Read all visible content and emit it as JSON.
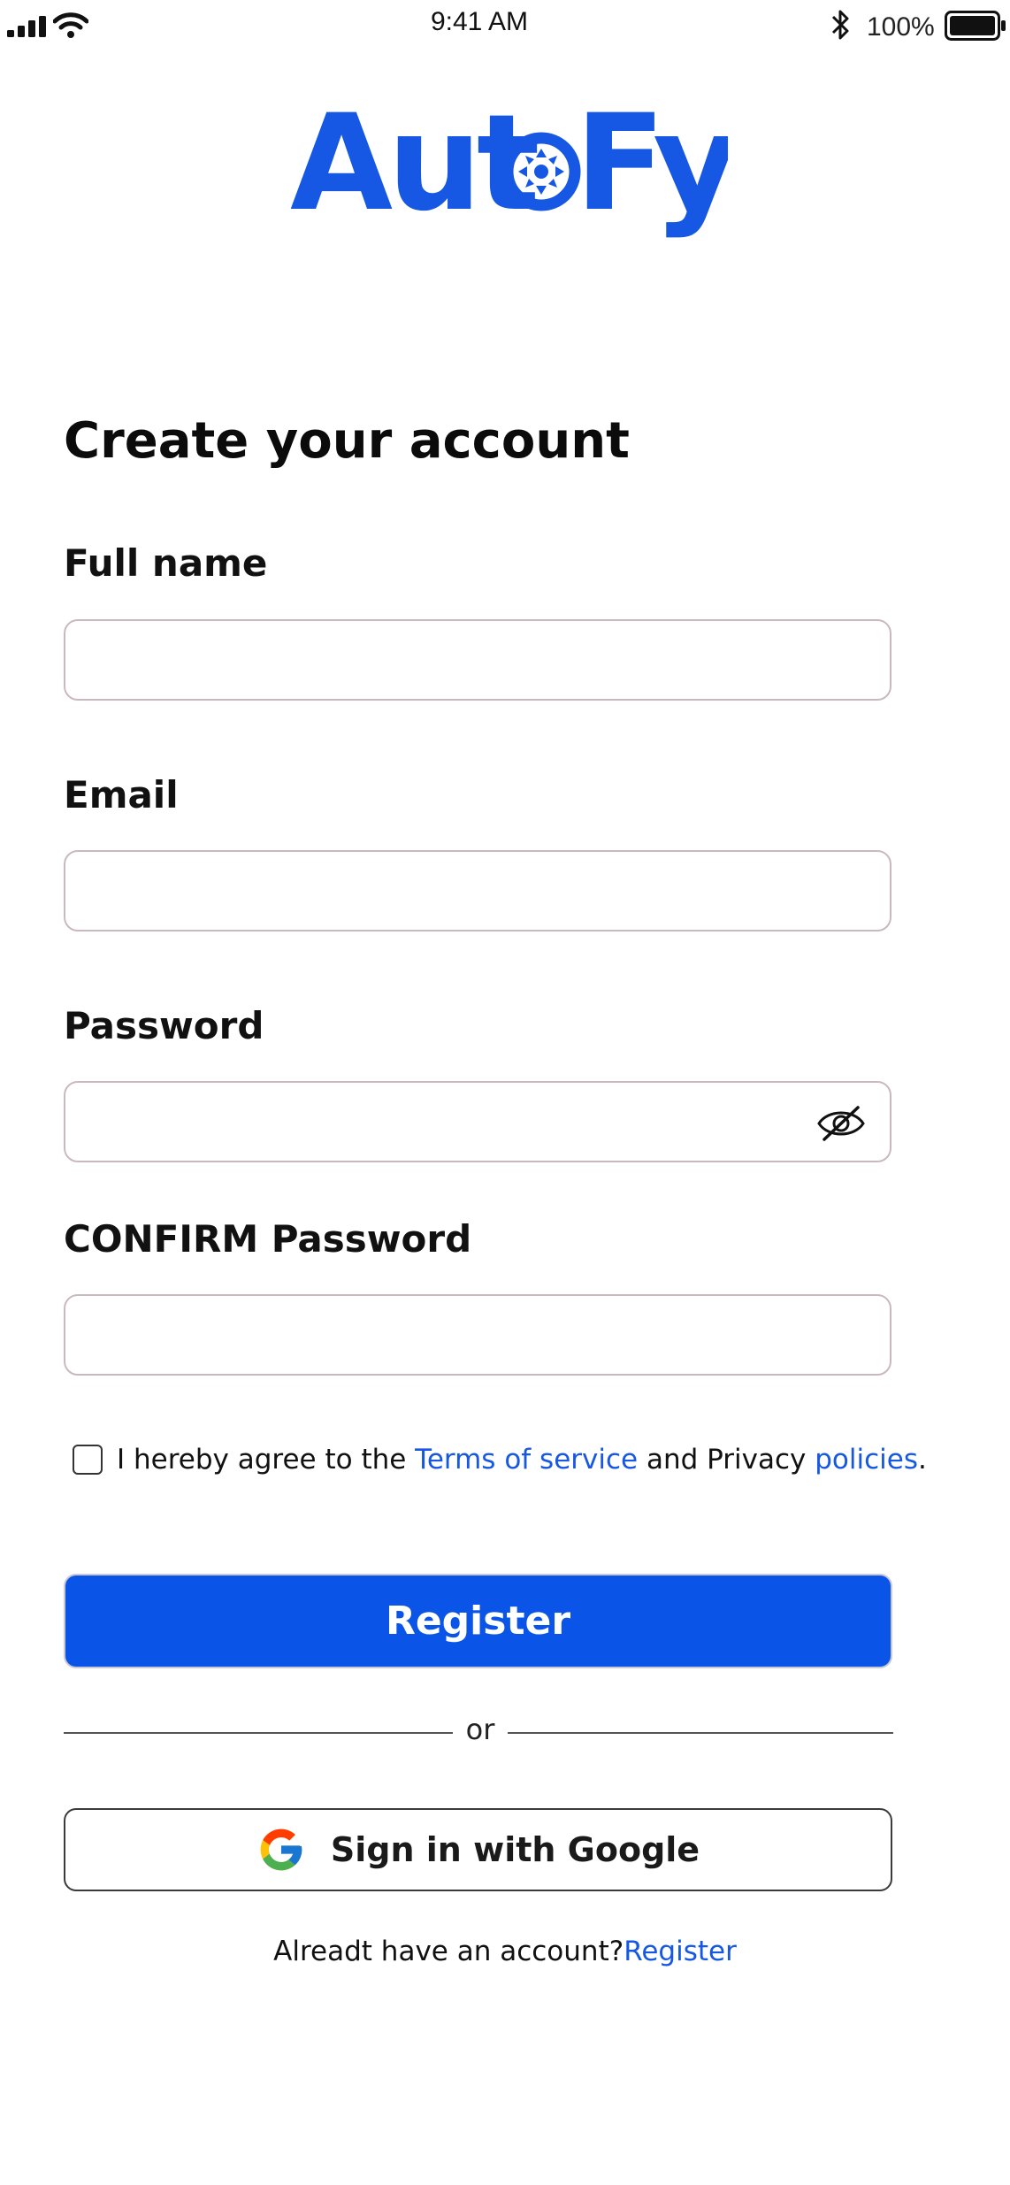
{
  "status_bar": {
    "time": "9:41 AM",
    "battery_percent": "100%",
    "icons": [
      "signal-icon",
      "wifi-icon",
      "bluetooth-icon",
      "battery-icon"
    ]
  },
  "brand": {
    "logo_text_left": "Aut",
    "logo_text_right": "Fy",
    "accent_color": "#1658e3"
  },
  "form": {
    "title": "Create your account",
    "fields": {
      "full_name": {
        "label": "Full name",
        "value": "",
        "placeholder": ""
      },
      "email": {
        "label": "Email",
        "value": "",
        "placeholder": ""
      },
      "password": {
        "label": "Password",
        "value": "",
        "placeholder": "",
        "toggle_icon": "eye-slash-icon"
      },
      "confirm_password": {
        "label": "CONFIRM Password",
        "value": "",
        "placeholder": ""
      }
    },
    "terms": {
      "checked": false,
      "prefix": "I hereby agree to the ",
      "terms_link": "Terms of service",
      "middle": " and Privacy ",
      "policies_link": "policies",
      "suffix": "."
    },
    "register_button": "Register",
    "divider_text": "or",
    "google_button": "Sign in with Google",
    "account_prompt": "Alreadt have an account?",
    "account_link": "Register"
  },
  "colors": {
    "primary_button": "#0b54e8",
    "link": "#1658e3",
    "field_border": "#c9b9bd"
  }
}
